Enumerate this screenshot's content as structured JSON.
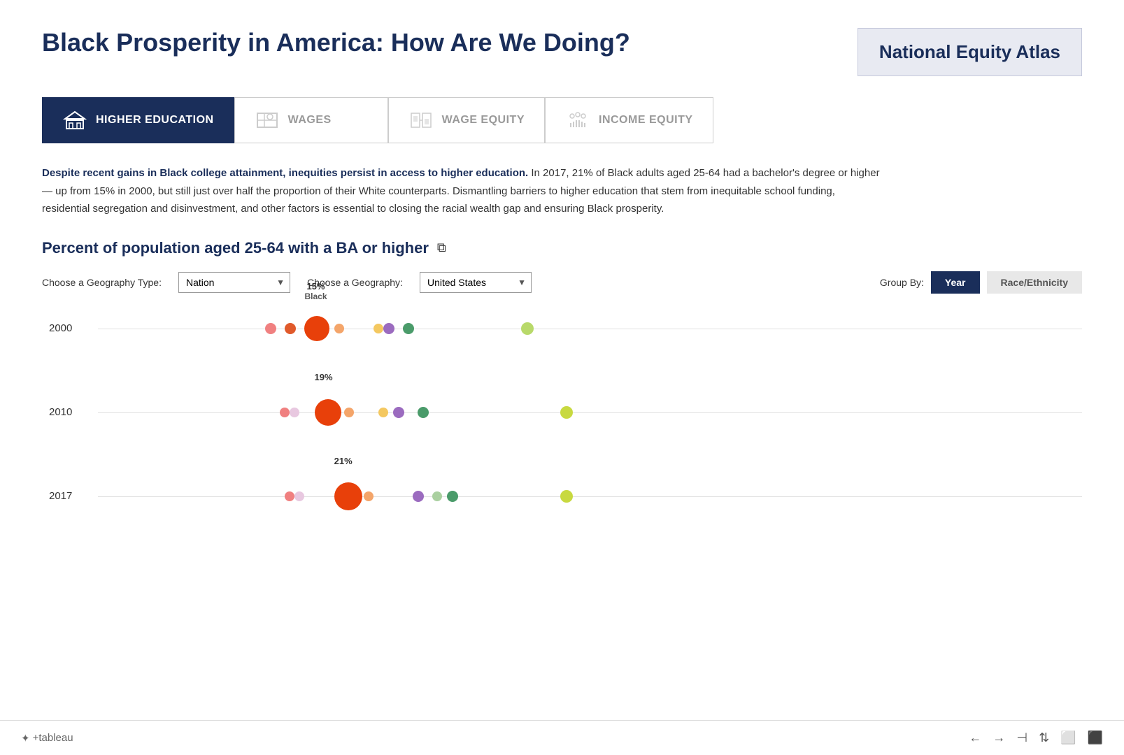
{
  "header": {
    "title": "Black Prosperity in America: How Are We Doing?",
    "atlas_name": "National Equity Atlas"
  },
  "tabs": [
    {
      "id": "higher-education",
      "label": "HIGHER EDUCATION",
      "active": true
    },
    {
      "id": "wages",
      "label": "WAGES",
      "active": false
    },
    {
      "id": "wage-equity",
      "label": "WAGE EQUITY",
      "active": false
    },
    {
      "id": "income-equity",
      "label": "INCOME EQUITY",
      "active": false
    }
  ],
  "description": {
    "bold_text": "Despite recent gains in Black college attainment, inequities persist in access to higher education.",
    "body_text": " In 2017, 21% of Black adults aged 25-64 had a bachelor's degree or higher — up from 15% in 2000, but still just over half the proportion of their White counterparts. Dismantling barriers to higher education that stem from inequitable school funding, residential segregation and disinvestment, and other factors is essential to closing the racial wealth gap and ensuring Black prosperity."
  },
  "chart": {
    "title": "Percent of population aged 25-64 with a BA or higher",
    "geography_type_label": "Choose a Geography Type:",
    "geography_type_value": "Nation",
    "geography_label": "Choose a Geography:",
    "geography_value": "United States",
    "group_by_label": "Group By:",
    "group_by_options": [
      "Year",
      "Race/Ethnicity"
    ],
    "group_by_active": "Year",
    "rows": [
      {
        "year": "2000",
        "black_pct": "15%",
        "black_label": "Black",
        "dots": [
          {
            "color": "#f08080",
            "size": 16,
            "left_pct": 17
          },
          {
            "color": "#e05a2b",
            "size": 16,
            "left_pct": 19
          },
          {
            "color": "#e8400a",
            "size": 36,
            "left_pct": 21,
            "tooltip": "15%",
            "tooltip_sub": "Black"
          },
          {
            "color": "#f4a56a",
            "size": 14,
            "left_pct": 24
          },
          {
            "color": "#f4c860",
            "size": 14,
            "left_pct": 28
          },
          {
            "color": "#9b6bbf",
            "size": 16,
            "left_pct": 29
          },
          {
            "color": "#4a9b6a",
            "size": 16,
            "left_pct": 31
          },
          {
            "color": "#b8d96a",
            "size": 18,
            "left_pct": 43
          }
        ]
      },
      {
        "year": "2010",
        "black_pct": "19%",
        "dots": [
          {
            "color": "#f08080",
            "size": 14,
            "left_pct": 18.5
          },
          {
            "color": "#e8d0e8",
            "size": 14,
            "left_pct": 19.5
          },
          {
            "color": "#e8400a",
            "size": 38,
            "left_pct": 22,
            "tooltip": "19%",
            "tooltip_sub": ""
          },
          {
            "color": "#f4a56a",
            "size": 14,
            "left_pct": 25
          },
          {
            "color": "#f4c860",
            "size": 14,
            "left_pct": 28.5
          },
          {
            "color": "#9b6bbf",
            "size": 16,
            "left_pct": 30
          },
          {
            "color": "#4a9b6a",
            "size": 16,
            "left_pct": 32.5
          },
          {
            "color": "#c8d940",
            "size": 18,
            "left_pct": 47
          }
        ]
      },
      {
        "year": "2017",
        "black_pct": "21%",
        "dots": [
          {
            "color": "#f08080",
            "size": 14,
            "left_pct": 19
          },
          {
            "color": "#e8d0e8",
            "size": 14,
            "left_pct": 20
          },
          {
            "color": "#e8400a",
            "size": 40,
            "left_pct": 24,
            "tooltip": "21%",
            "tooltip_sub": ""
          },
          {
            "color": "#f4a56a",
            "size": 14,
            "left_pct": 27
          },
          {
            "color": "#9b6bbf",
            "size": 16,
            "left_pct": 32
          },
          {
            "color": "#aad0a0",
            "size": 14,
            "left_pct": 34
          },
          {
            "color": "#4a9b6a",
            "size": 16,
            "left_pct": 35.5
          },
          {
            "color": "#c8d940",
            "size": 18,
            "left_pct": 47
          }
        ]
      }
    ]
  },
  "footer": {
    "tableau_text": "✦ + a b l e a u",
    "nav_icons": [
      "←",
      "→",
      "⊣",
      "⇅",
      "⬜",
      "⬛"
    ]
  }
}
